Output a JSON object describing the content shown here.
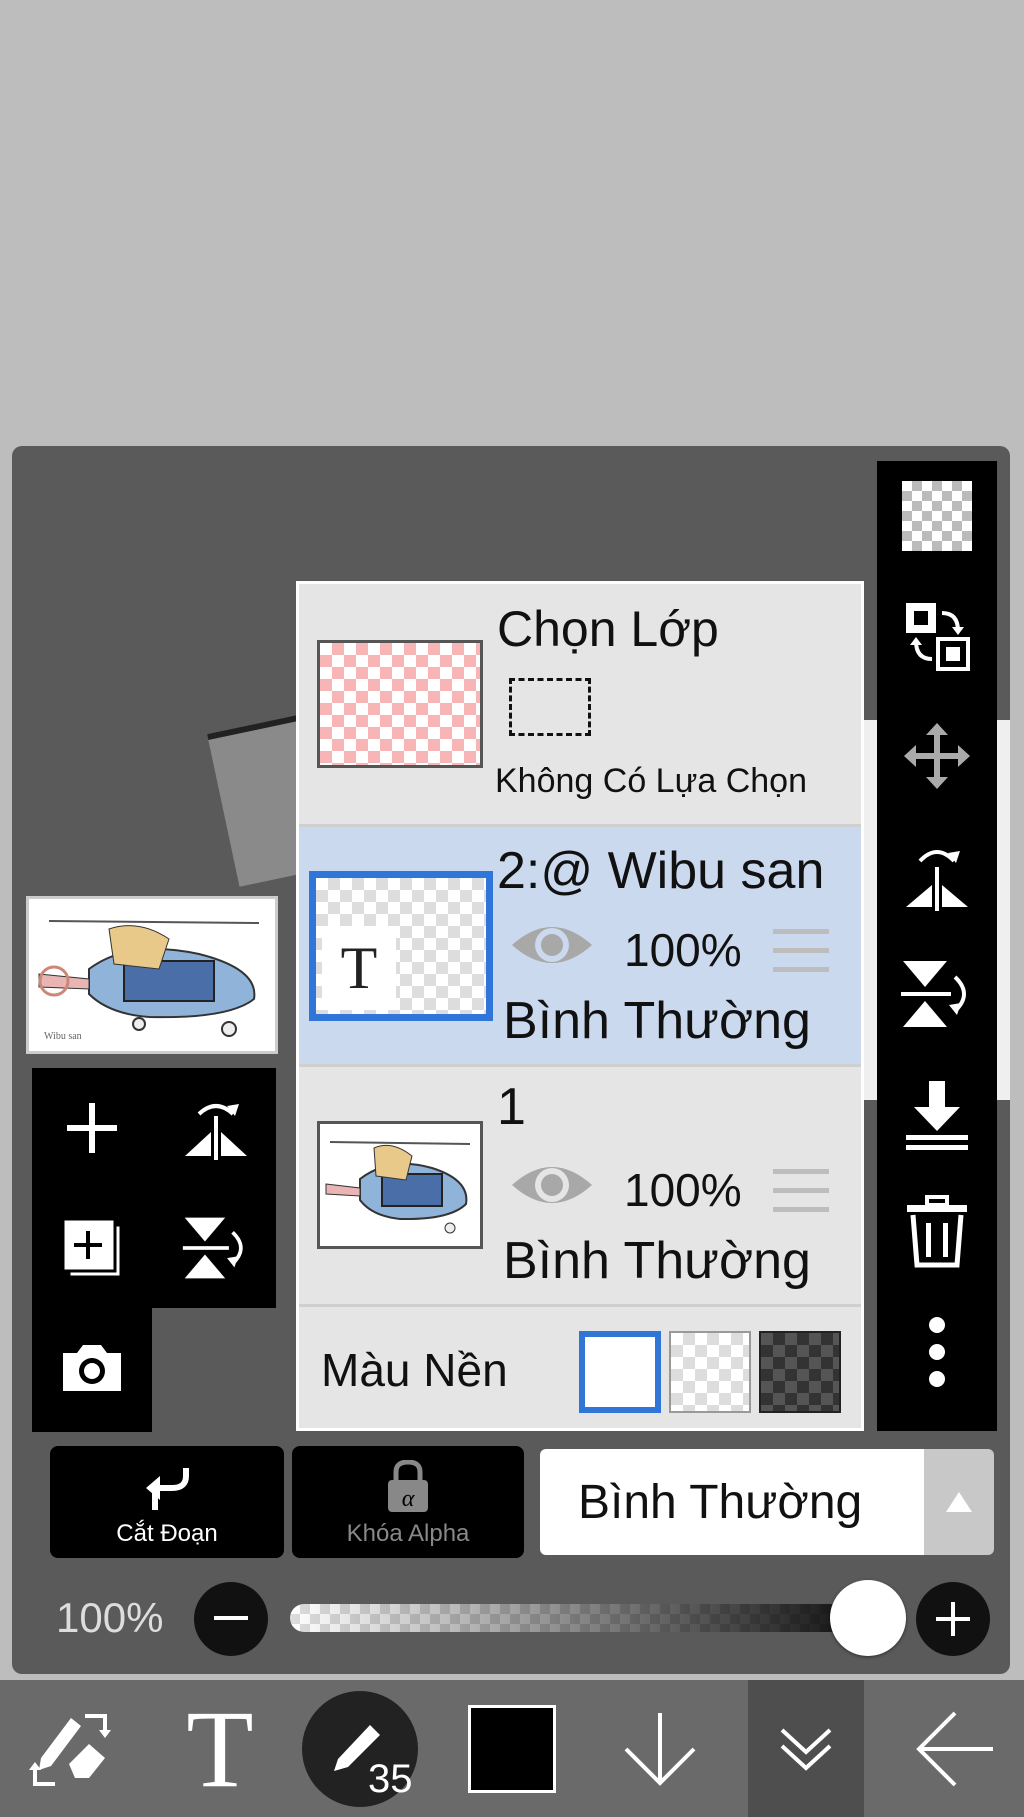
{
  "layer_panel": {
    "selection": {
      "title": "Chọn Lớp",
      "status": "Không Có Lựa Chọn"
    },
    "layers": [
      {
        "name": "2:@ Wibu san",
        "opacity": "100%",
        "blend": "Bình Thường",
        "selected": true,
        "type": "text"
      },
      {
        "name": "1",
        "opacity": "100%",
        "blend": "Bình Thường",
        "selected": false,
        "type": "image"
      }
    ],
    "background": {
      "label": "Màu Nền",
      "options": [
        "white",
        "transparent",
        "dark-checker"
      ],
      "selected": "white"
    }
  },
  "actions": {
    "clipping_label": "Cắt Đoạn",
    "alpha_lock_label": "Khóa Alpha",
    "blend_mode_value": "Bình Thường"
  },
  "opacity": {
    "label": "100%",
    "value": 1.0
  },
  "bottom_toolbar": {
    "brush_size": "35",
    "color": "#000000"
  },
  "colors": {
    "accent": "#2f76d8",
    "selected_row": "#cbd9ee",
    "panel": "#5a5a5a"
  }
}
